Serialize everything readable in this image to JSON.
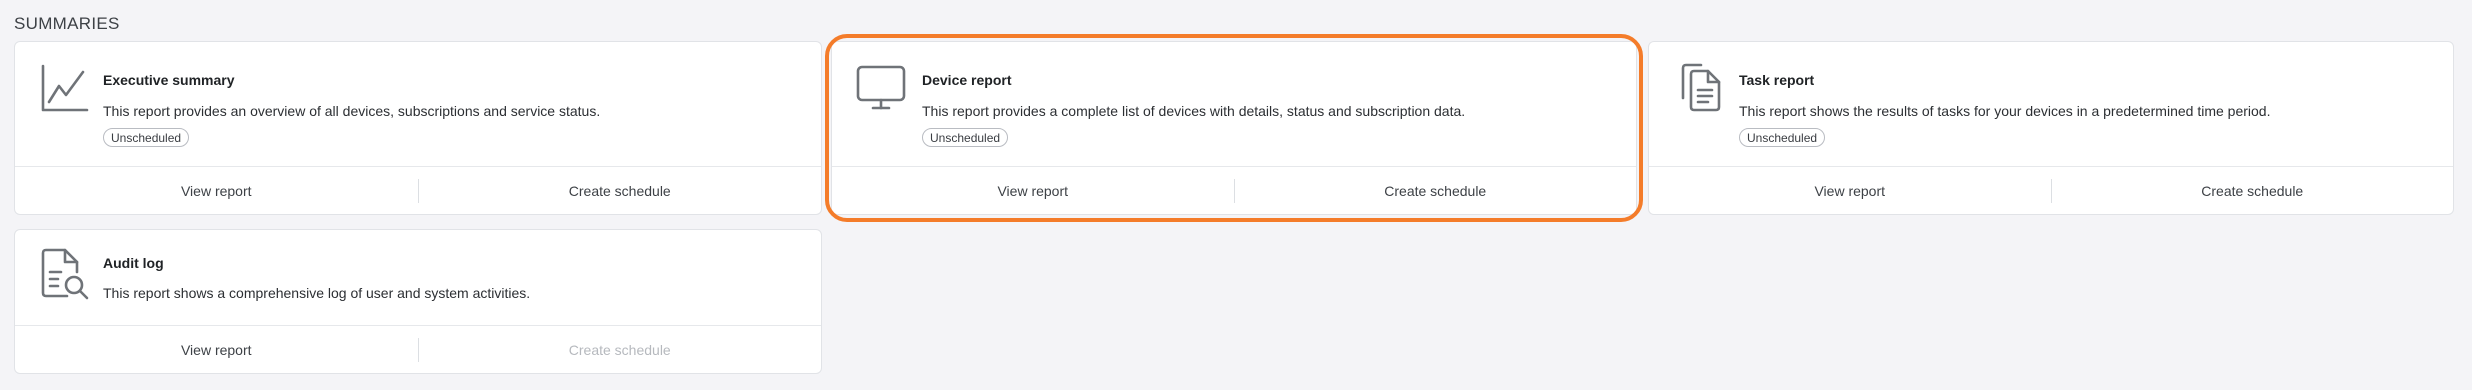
{
  "section": {
    "title": "SUMMARIES"
  },
  "colors": {
    "highlight": "#f47c2a",
    "card_bg": "#ffffff",
    "page_bg": "#f4f4f7"
  },
  "cards": [
    {
      "icon": "line-chart-icon",
      "title": "Executive summary",
      "description": "This report provides an overview of all devices, subscriptions and service status.",
      "badge": "Unscheduled",
      "view_label": "View report",
      "schedule_label": "Create schedule"
    },
    {
      "icon": "monitor-icon",
      "title": "Device report",
      "description": "This report provides a complete list of devices with details, status and subscription data.",
      "badge": "Unscheduled",
      "view_label": "View report",
      "schedule_label": "Create schedule"
    },
    {
      "icon": "documents-icon",
      "title": "Task report",
      "description": "This report shows the results of tasks for your devices in a predetermined time period.",
      "badge": "Unscheduled",
      "view_label": "View report",
      "schedule_label": "Create schedule"
    },
    {
      "icon": "document-search-icon",
      "title": "Audit log",
      "description": "This report shows a comprehensive log of user and system activities.",
      "view_label": "View report",
      "schedule_label": "Create schedule",
      "schedule_disabled": true
    }
  ]
}
